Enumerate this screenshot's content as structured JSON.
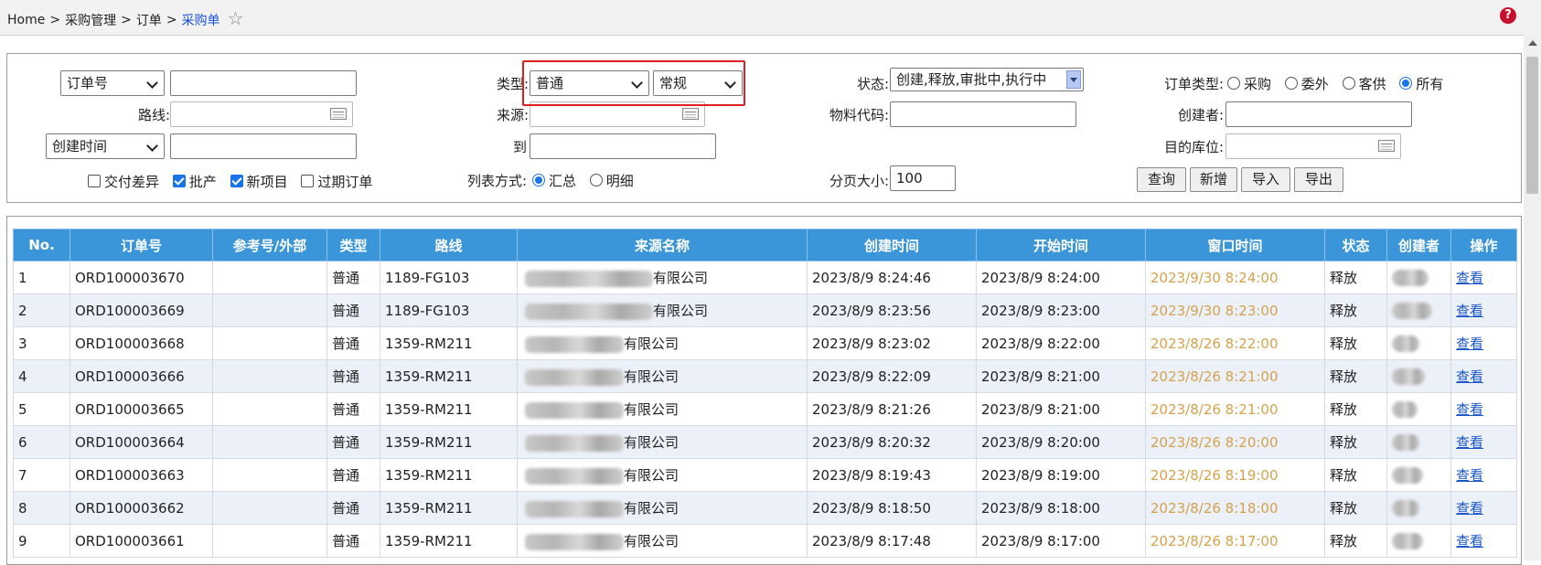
{
  "breadcrumb": {
    "items": [
      "Home",
      "采购管理",
      "订单",
      "采购单"
    ],
    "separator": ">"
  },
  "icons": {
    "favorite": "star-outline-icon",
    "help": "help-icon"
  },
  "filter": {
    "order_field_select": "订单号",
    "order_field_value": "",
    "route_label": "路线:",
    "date_field_select": "创建时间",
    "date_value": "",
    "checkboxes": [
      {
        "label": "交付差异",
        "checked": false
      },
      {
        "label": "批产",
        "checked": true
      },
      {
        "label": "新项目",
        "checked": true
      },
      {
        "label": "过期订单",
        "checked": false
      }
    ],
    "type_label": "类型:",
    "type_select": "普通",
    "type_sub_select": "常规",
    "source_label": "来源:",
    "to_label": "到",
    "list_mode_label": "列表方式:",
    "list_mode_options": [
      {
        "label": "汇总",
        "checked": true
      },
      {
        "label": "明细",
        "checked": false
      }
    ],
    "status_label": "状态:",
    "status_value": "创建,释放,审批中,执行中",
    "material_label": "物料代码:",
    "page_size_label": "分页大小:",
    "page_size_value": "100",
    "order_type_label": "订单类型:",
    "order_type_options": [
      {
        "label": "采购",
        "checked": false
      },
      {
        "label": "委外",
        "checked": false
      },
      {
        "label": "客供",
        "checked": false
      },
      {
        "label": "所有",
        "checked": true
      }
    ],
    "creator_label": "创建者:",
    "dest_label": "目的库位:",
    "buttons": {
      "query": "查询",
      "add": "新增",
      "import": "导入",
      "export": "导出"
    }
  },
  "table": {
    "headers": [
      "No.",
      "订单号",
      "参考号/外部",
      "类型",
      "路线",
      "来源名称",
      "创建时间",
      "开始时间",
      "窗口时间",
      "状态",
      "创建者",
      "操作"
    ],
    "rows": [
      {
        "no": "1",
        "order": "ORD100003670",
        "ref": "",
        "type": "普通",
        "route": "1189-FG103",
        "source": "有限公司",
        "created": "2023/8/9 8:24:46",
        "start": "2023/8/9 8:24:00",
        "window": "2023/9/30 8:24:00",
        "status": "释放",
        "action": "查看"
      },
      {
        "no": "2",
        "order": "ORD100003669",
        "ref": "",
        "type": "普通",
        "route": "1189-FG103",
        "source": "有限公司",
        "created": "2023/8/9 8:23:56",
        "start": "2023/8/9 8:23:00",
        "window": "2023/9/30 8:23:00",
        "status": "释放",
        "action": "查看"
      },
      {
        "no": "3",
        "order": "ORD100003668",
        "ref": "",
        "type": "普通",
        "route": "1359-RM211",
        "source": "有限公司",
        "created": "2023/8/9 8:23:02",
        "start": "2023/8/9 8:22:00",
        "window": "2023/8/26 8:22:00",
        "status": "释放",
        "action": "查看"
      },
      {
        "no": "4",
        "order": "ORD100003666",
        "ref": "",
        "type": "普通",
        "route": "1359-RM211",
        "source": "有限公司",
        "created": "2023/8/9 8:22:09",
        "start": "2023/8/9 8:21:00",
        "window": "2023/8/26 8:21:00",
        "status": "释放",
        "action": "查看"
      },
      {
        "no": "5",
        "order": "ORD100003665",
        "ref": "",
        "type": "普通",
        "route": "1359-RM211",
        "source": "有限公司",
        "created": "2023/8/9 8:21:26",
        "start": "2023/8/9 8:21:00",
        "window": "2023/8/26 8:21:00",
        "status": "释放",
        "action": "查看"
      },
      {
        "no": "6",
        "order": "ORD100003664",
        "ref": "",
        "type": "普通",
        "route": "1359-RM211",
        "source": "有限公司",
        "created": "2023/8/9 8:20:32",
        "start": "2023/8/9 8:20:00",
        "window": "2023/8/26 8:20:00",
        "status": "释放",
        "action": "查看"
      },
      {
        "no": "7",
        "order": "ORD100003663",
        "ref": "",
        "type": "普通",
        "route": "1359-RM211",
        "source": "有限公司",
        "created": "2023/8/9 8:19:43",
        "start": "2023/8/9 8:19:00",
        "window": "2023/8/26 8:19:00",
        "status": "释放",
        "action": "查看"
      },
      {
        "no": "8",
        "order": "ORD100003662",
        "ref": "",
        "type": "普通",
        "route": "1359-RM211",
        "source": "有限公司",
        "created": "2023/8/9 8:18:50",
        "start": "2023/8/9 8:18:00",
        "window": "2023/8/26 8:18:00",
        "status": "释放",
        "action": "查看"
      },
      {
        "no": "9",
        "order": "ORD100003661",
        "ref": "",
        "type": "普通",
        "route": "1359-RM211",
        "source": "有限公司",
        "created": "2023/8/9 8:17:48",
        "start": "2023/8/9 8:17:00",
        "window": "2023/8/26 8:17:00",
        "status": "释放",
        "action": "查看"
      }
    ]
  },
  "colors": {
    "header_bg": "#3b95d9",
    "row_alt_bg": "#ecf1f9",
    "window_time": "#d4a24c",
    "link": "#1a55c9",
    "highlight_box": "#e02020"
  }
}
